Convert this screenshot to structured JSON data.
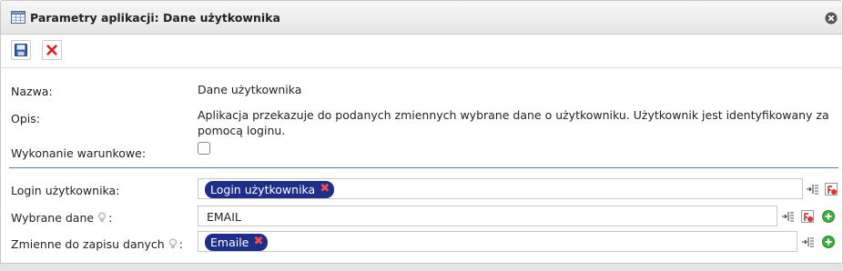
{
  "window": {
    "title": "Parametry aplikacji: Dane użytkownika"
  },
  "toolbar": {
    "save": "save-icon",
    "cancel": "delete-icon"
  },
  "form": {
    "nazwa_label": "Nazwa:",
    "nazwa_value": "Dane użytkownika",
    "opis_label": "Opis:",
    "opis_value": "Aplikacja przekazuje do podanych zmiennych wybrane dane o użytkowniku. Użytkownik jest identyfikowany za pomocą loginu.",
    "wykonanie_label": "Wykonanie warunkowe:",
    "wykonanie_checked": false,
    "login_label": "Login użytkownika:",
    "login_tag": "Login użytkownika",
    "wybrane_label": "Wybrane dane",
    "wybrane_colon": ":",
    "wybrane_value": "EMAIL",
    "zmienne_label": "Zmienne do zapisu danych",
    "zmienne_colon": ":",
    "zmienne_tag": "Emaile",
    "tag_remove": "✖"
  },
  "colors": {
    "tag_bg": "#1d2f8a",
    "separator": "#5a7c9a",
    "remove": "#ff4a4a",
    "add": "#3cae3c"
  }
}
